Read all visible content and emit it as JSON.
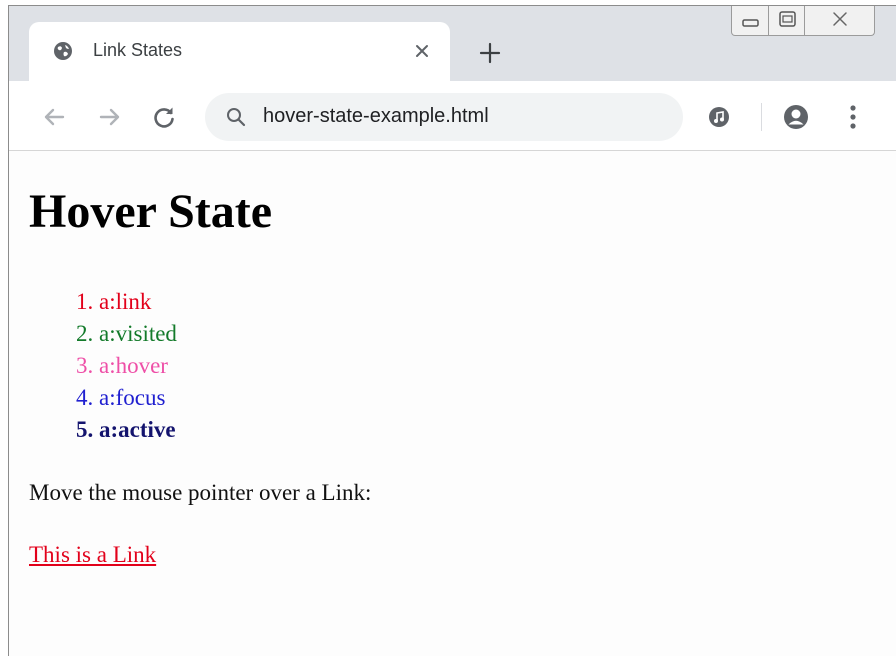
{
  "browser": {
    "tab": {
      "title": "Link States",
      "favicon": "globe-icon"
    },
    "address_bar": {
      "url": "hover-state-example.html",
      "icon": "search-icon"
    },
    "toolbar_icons": [
      "back-icon",
      "forward-icon",
      "reload-icon",
      "media-icon",
      "profile-icon",
      "menu-icon"
    ],
    "window_controls": [
      "minimize-icon",
      "restore-icon",
      "close-icon"
    ]
  },
  "page": {
    "heading": "Hover State",
    "list": [
      {
        "label": "a:link",
        "color": "#e2001a"
      },
      {
        "label": "a:visited",
        "color": "#137a2a"
      },
      {
        "label": "a:hover",
        "color": "#ee4fa7"
      },
      {
        "label": "a:focus",
        "color": "#2020d0"
      },
      {
        "label": "a:active",
        "color": "#14146e"
      }
    ],
    "instruction": "Move the mouse pointer over a Link:",
    "demo_link": "This is a Link"
  },
  "colors": {
    "tabstrip_bg": "#dee1e6",
    "omnibox_bg": "#f1f3f4",
    "link_red": "#e2001a"
  }
}
